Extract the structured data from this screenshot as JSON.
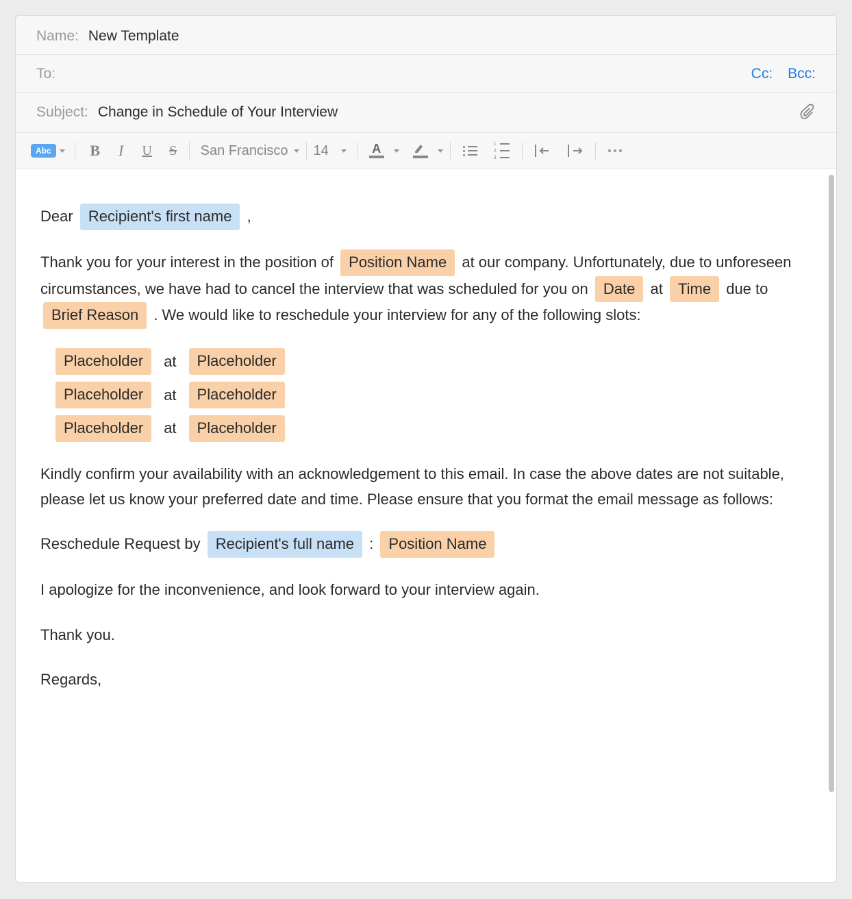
{
  "header": {
    "name_label": "Name:",
    "name_value": "New Template",
    "to_label": "To:",
    "cc_label": "Cc:",
    "bcc_label": "Bcc:",
    "subject_label": "Subject:",
    "subject_value": "Change in Schedule of Your Interview"
  },
  "toolbar": {
    "abc_label": "Abc",
    "bold": "B",
    "italic": "I",
    "underline": "U",
    "strike": "S",
    "font_name": "San Francisco",
    "font_size": "14",
    "text_color_letter": "A"
  },
  "body": {
    "dear": "Dear",
    "recipient_first": "Recipient's first name",
    "comma": ",",
    "p1_a": "Thank you for your interest in the position of",
    "position_name": "Position Name",
    "p1_b": "at our company. Unfortunately, due to unforeseen circumstances, we have had to cancel the interview that was scheduled for you on",
    "date_ph": "Date",
    "at_word": "at",
    "time_ph": "Time",
    "p1_c": "due to",
    "brief_reason": "Brief Reason",
    "p1_d": ". We would like to reschedule your interview for any of the following slots:",
    "slot_ph": "Placeholder",
    "p2": "Kindly confirm your availability with an acknowledgement to this email. In case the above dates are not suitable, please let us know your preferred date and time. Please ensure that you format the email message as follows:",
    "resched_label": "Reschedule Request by",
    "recipient_full": "Recipient's full name",
    "colon": ":",
    "position_name2": "Position Name",
    "apology": "I apologize for the inconvenience, and look forward to your interview again.",
    "thank_you": "Thank you.",
    "regards": "Regards,"
  }
}
